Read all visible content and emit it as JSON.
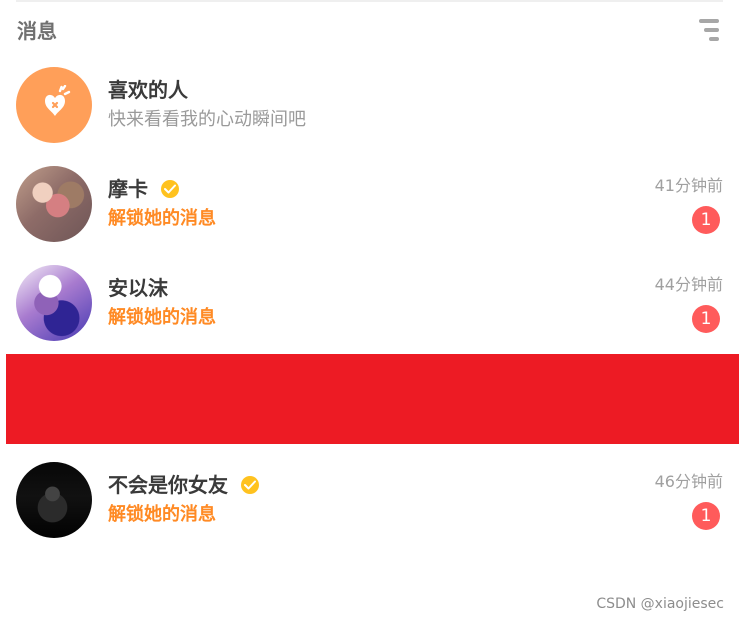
{
  "header": {
    "title": "消息",
    "menu_icon": "menu-lines-icon"
  },
  "rows": [
    {
      "name": "喜欢的人",
      "subtitle": "快来看看我的心动瞬间吧",
      "avatar_icon": "heart-spark-icon"
    },
    {
      "name": "摩卡",
      "subtitle": "解锁她的消息",
      "time": "41分钟前",
      "badge": "1",
      "verified": true
    },
    {
      "name": "安以沫",
      "subtitle": "解锁她的消息",
      "time": "44分钟前",
      "badge": "1",
      "verified": false
    },
    {
      "name": "不会是你女友",
      "subtitle": "解锁她的消息",
      "time": "46分钟前",
      "badge": "1",
      "verified": true
    }
  ],
  "footer": {
    "watermark": "CSDN @xiaojiesec"
  },
  "colors": {
    "accent_orange": "#ff8a24",
    "badge_red": "#ff5b5b",
    "banner_red": "#ed1b24",
    "verified_yellow": "#ffc21f"
  }
}
